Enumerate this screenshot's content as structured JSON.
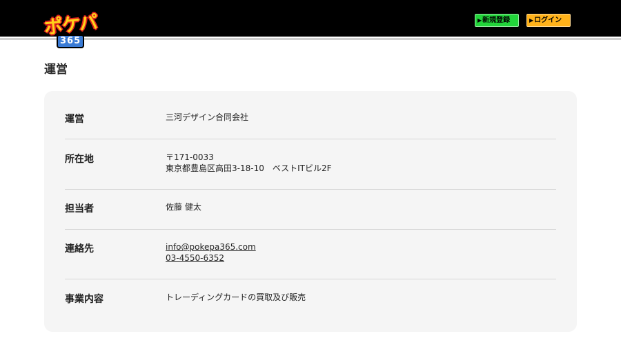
{
  "header": {
    "logo_text": "ポケパ",
    "logo_sub": "365",
    "register_label": "新規登録",
    "login_label": "ログイン",
    "colors": {
      "background": "#000000",
      "register": "#22d43a",
      "login": "#ffb21a",
      "logo": "#ffd21a"
    }
  },
  "page": {
    "title": "運営"
  },
  "info": {
    "rows": [
      {
        "label": "運営",
        "lines": [
          "三河デザイン合同会社"
        ]
      },
      {
        "label": "所在地",
        "lines": [
          "〒171-0033",
          "東京都豊島区高田3-18-10　ベストITビル2F"
        ]
      },
      {
        "label": "担当者",
        "lines": [
          "佐藤 健太"
        ]
      },
      {
        "label": "連絡先",
        "lines": [
          "info@pokepa365.com",
          "03-4550-6352"
        ]
      },
      {
        "label": "事業内容",
        "lines": [
          "トレーディングカードの買取及び販売"
        ]
      }
    ]
  }
}
